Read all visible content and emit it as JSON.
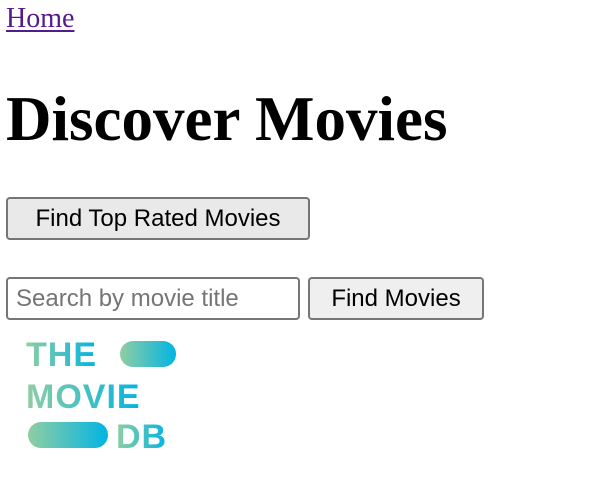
{
  "nav": {
    "home_label": "Home"
  },
  "page": {
    "title": "Discover Movies"
  },
  "actions": {
    "top_rated_label": "Find Top Rated Movies",
    "find_movies_label": "Find Movies"
  },
  "search": {
    "placeholder": "Search by movie title",
    "value": ""
  },
  "logo": {
    "name": "tmdb-logo",
    "line1": "THE",
    "line2": "MOVIE",
    "line3": "DB",
    "colors": {
      "gradient_start": "#90cea1",
      "gradient_end": "#01b4e4"
    }
  },
  "colors": {
    "link_visited": "#551a8b",
    "button_bg": "#efefef",
    "border": "#767676"
  }
}
